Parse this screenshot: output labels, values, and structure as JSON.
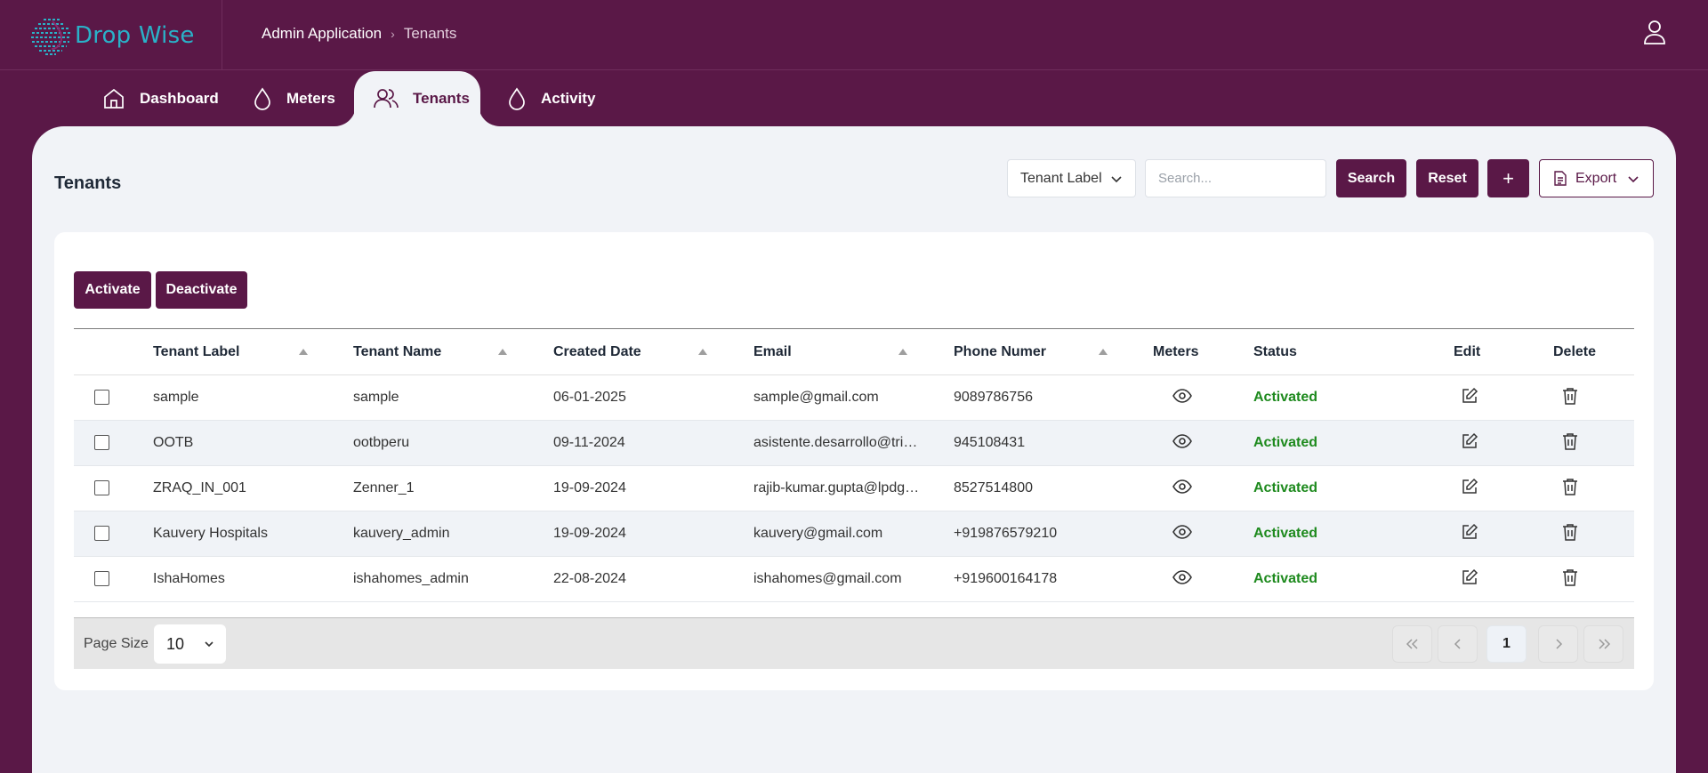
{
  "app": {
    "logo_text": "Drop Wise"
  },
  "breadcrumb": {
    "root": "Admin Application",
    "separator": "›",
    "current": "Tenants"
  },
  "nav": {
    "tabs": [
      {
        "label": "Dashboard",
        "icon": "home-icon"
      },
      {
        "label": "Meters",
        "icon": "droplet-icon"
      },
      {
        "label": "Tenants",
        "icon": "users-icon",
        "active": true
      },
      {
        "label": "Activity",
        "icon": "droplet-icon"
      }
    ]
  },
  "page": {
    "title": "Tenants"
  },
  "toolbar": {
    "filter_selected": "Tenant Label",
    "search_placeholder": "Search...",
    "search_label": "Search",
    "reset_label": "Reset",
    "add_label": "+",
    "export_label": "Export"
  },
  "actions": {
    "activate_label": "Activate",
    "deactivate_label": "Deactivate"
  },
  "table": {
    "columns": [
      "Tenant Label",
      "Tenant Name",
      "Created Date",
      "Email",
      "Phone Numer",
      "Meters",
      "Status",
      "Edit",
      "Delete"
    ],
    "rows": [
      {
        "label": "sample",
        "name": "sample",
        "created": "06-01-2025",
        "email": "sample@gmail.com",
        "phone": "9089786756",
        "status": "Activated"
      },
      {
        "label": "OOTB",
        "name": "ootbperu",
        "created": "09-11-2024",
        "email": "asistente.desarrollo@tri…",
        "phone": "945108431",
        "status": "Activated"
      },
      {
        "label": "ZRAQ_IN_001",
        "name": "Zenner_1",
        "created": "19-09-2024",
        "email": "rajib-kumar.gupta@lpdg…",
        "phone": "8527514800",
        "status": "Activated"
      },
      {
        "label": "Kauvery Hospitals",
        "name": "kauvery_admin",
        "created": "19-09-2024",
        "email": "kauvery@gmail.com",
        "phone": "+919876579210",
        "status": "Activated"
      },
      {
        "label": "IshaHomes",
        "name": "ishahomes_admin",
        "created": "22-08-2024",
        "email": "ishahomes@gmail.com",
        "phone": "+919600164178",
        "status": "Activated"
      }
    ]
  },
  "pagination": {
    "page_size_label": "Page Size",
    "page_size": "10",
    "current_page": "1"
  },
  "colors": {
    "brand": "#5a1847",
    "accent_logo": "#2ab1c8",
    "status_active": "#1e8a1e",
    "panel_bg": "#f1f3f7"
  }
}
